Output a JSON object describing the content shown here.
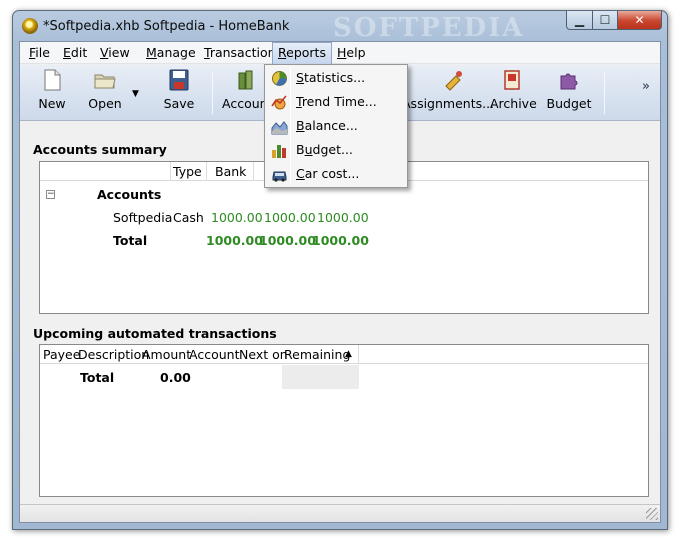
{
  "window": {
    "title": "*Softpedia.xhb Softpedia - HomeBank",
    "watermark": "SOFTPEDIA"
  },
  "menubar": {
    "items": [
      {
        "label": "File",
        "mnemonic": "F"
      },
      {
        "label": "Edit",
        "mnemonic": "E"
      },
      {
        "label": "View",
        "mnemonic": "V"
      },
      {
        "label": "Manage",
        "mnemonic": "M"
      },
      {
        "label": "Transactions",
        "mnemonic": "T"
      },
      {
        "label": "Reports",
        "mnemonic": "R",
        "active": true
      },
      {
        "label": "Help",
        "mnemonic": "H"
      }
    ]
  },
  "toolbar": {
    "new": "New",
    "open": "Open",
    "save": "Save",
    "accounts": "Accounts",
    "assignments": "Assignments...",
    "archive": "Archive",
    "budget": "Budget",
    "overflow": "»",
    "open_menu_arrow": "▼"
  },
  "reports_menu": {
    "items": [
      {
        "label": "Statistics...",
        "mnemonic": "S",
        "icon": "pie-chart-icon"
      },
      {
        "label": "Trend Time...",
        "mnemonic": "T",
        "icon": "trend-icon"
      },
      {
        "label": "Balance...",
        "mnemonic": "B",
        "icon": "area-chart-icon"
      },
      {
        "label": "Budget...",
        "mnemonic": "u",
        "icon": "bar-chart-icon"
      },
      {
        "label": "Car cost...",
        "mnemonic": "C",
        "icon": "car-icon"
      }
    ]
  },
  "accounts_summary": {
    "title": "Accounts summary",
    "columns": [
      "Type",
      "Bank"
    ],
    "group_label": "Accounts",
    "expander": "−",
    "rows": [
      {
        "name": "Softpedia",
        "type": "Cash",
        "bank": "1000.00",
        "today": "1000.00",
        "future": "1000.00"
      }
    ],
    "total": {
      "label": "Total",
      "bank": "1000.00",
      "today": "1000.00",
      "future": "1000.00"
    }
  },
  "upcoming": {
    "title": "Upcoming automated transactions",
    "columns": [
      "Payee",
      "Description",
      "Amount",
      "Account",
      "Next on",
      "Remaining"
    ],
    "sort_indicator": "▲",
    "total_label": "Total",
    "total_amount": "0.00"
  }
}
